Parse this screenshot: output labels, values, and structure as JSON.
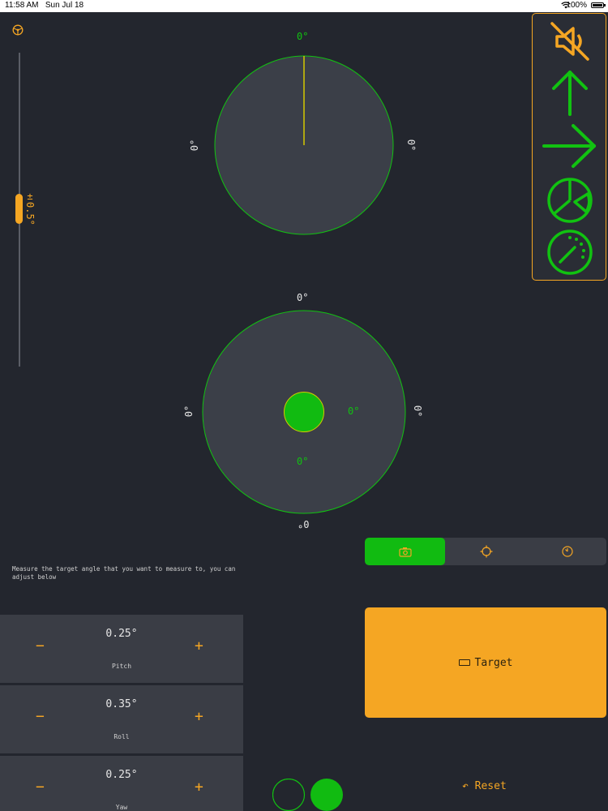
{
  "status_bar": {
    "time": "11:58 AM",
    "date": "Sun Jul 18",
    "battery": "100%"
  },
  "slider": {
    "value_label": "±0.5°"
  },
  "top_dial": {
    "top": "0°",
    "left": "0°",
    "right": "0°"
  },
  "bottom_dial": {
    "top": "0°",
    "left": "0°",
    "right": "0°",
    "bottom": "0°",
    "inner_x": "0°",
    "inner_y": "0°"
  },
  "instruction": "Measure the target angle that you want to measure to, you can adjust below",
  "steppers": [
    {
      "value": "0.25°",
      "name": "Pitch"
    },
    {
      "value": "0.35°",
      "name": "Roll"
    },
    {
      "value": "0.25°",
      "name": "Yaw"
    }
  ],
  "stepper_symbols": {
    "minus": "−",
    "plus": "+"
  },
  "target_button": {
    "label": "Target"
  },
  "reset_button": {
    "label": "Reset",
    "icon": "↶"
  },
  "colors": {
    "accent": "#f5a623",
    "green": "#11c211",
    "background": "#23262e",
    "panel": "#3a3d45"
  }
}
